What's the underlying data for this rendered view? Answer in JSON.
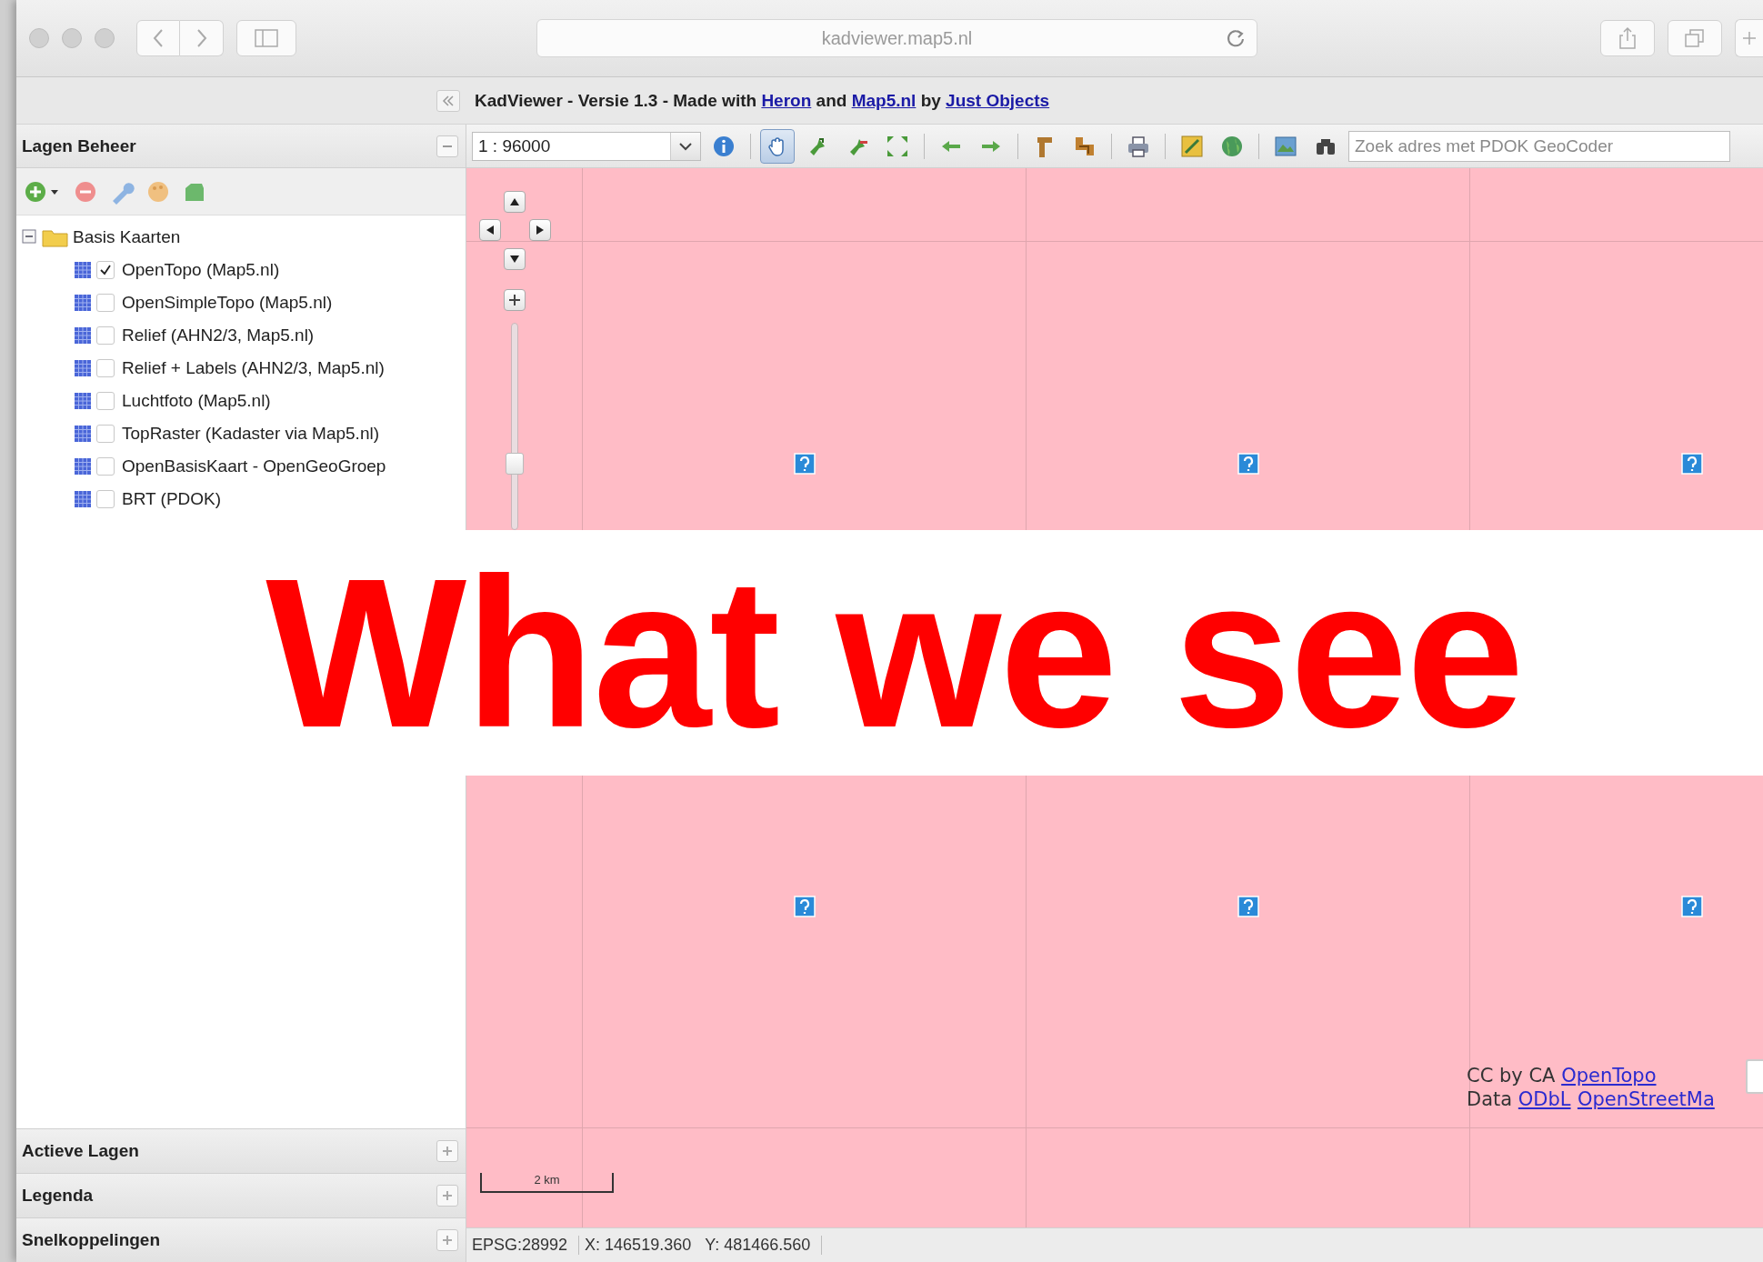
{
  "browser": {
    "url": "kadviewer.map5.nl"
  },
  "header": {
    "parts": [
      {
        "kind": "text",
        "text": "KadViewer - Versie 1.3 - Made with "
      },
      {
        "kind": "link",
        "text": "Heron"
      },
      {
        "kind": "text",
        "text": " and "
      },
      {
        "kind": "link",
        "text": "Map5.nl"
      },
      {
        "kind": "text",
        "text": " by "
      },
      {
        "kind": "link",
        "text": "Just Objects"
      }
    ]
  },
  "layers_panel": {
    "title": "Lagen Beheer",
    "tree": [
      {
        "label": "Basis Kaarten",
        "expanded": true,
        "children": [
          {
            "label": "OpenTopo (Map5.nl)",
            "checked": true
          },
          {
            "label": "OpenSimpleTopo (Map5.nl)",
            "checked": false
          },
          {
            "label": "Relief (AHN2/3, Map5.nl)",
            "checked": false
          },
          {
            "label": "Relief + Labels (AHN2/3, Map5.nl)",
            "checked": false
          },
          {
            "label": "Luchtfoto (Map5.nl)",
            "checked": false
          },
          {
            "label": "TopRaster (Kadaster via Map5.nl)",
            "checked": false
          },
          {
            "label": "OpenBasisKaart - OpenGeoGroep",
            "checked": false
          },
          {
            "label": "BRT (PDOK)",
            "checked": false
          }
        ]
      }
    ]
  },
  "map_toolbar": {
    "scale": "1 : 96000",
    "tool_groups": [
      [
        {
          "kind": "info",
          "selected": false
        }
      ],
      [
        {
          "kind": "pan",
          "selected": true
        },
        {
          "kind": "zoom-in",
          "selected": false
        },
        {
          "kind": "zoom-out",
          "selected": false
        },
        {
          "kind": "extent",
          "selected": false
        }
      ],
      [
        {
          "kind": "back",
          "selected": false
        },
        {
          "kind": "forward",
          "selected": false
        }
      ],
      [
        {
          "kind": "measure-length",
          "selected": false
        },
        {
          "kind": "measure-area",
          "selected": false
        }
      ],
      [
        {
          "kind": "print",
          "selected": false
        }
      ],
      [
        {
          "kind": "draw",
          "selected": false
        },
        {
          "kind": "globe",
          "selected": false
        }
      ],
      [
        {
          "kind": "map",
          "selected": false
        },
        {
          "kind": "binoculars",
          "selected": false
        }
      ]
    ],
    "search": {
      "placeholder": "Zoek adres met PDOK GeoCoder"
    }
  },
  "map": {
    "scale_bar": "2 km",
    "attribution": [
      [
        {
          "kind": "text",
          "text": "CC by CA "
        },
        {
          "kind": "link",
          "text": "OpenTopo"
        }
      ],
      [
        {
          "kind": "text",
          "text": "Data "
        },
        {
          "kind": "link",
          "text": "ODbL"
        },
        {
          "kind": "link",
          "text": "OpenStreetMa"
        }
      ]
    ]
  },
  "panels": [
    {
      "title": "Actieve Lagen"
    },
    {
      "title": "Legenda"
    },
    {
      "title": "Snelkoppelingen"
    }
  ],
  "status_bar": {
    "projection": "EPSG:28992",
    "x": "X: 146519.360",
    "y": "Y: 481466.560"
  },
  "banner": {
    "text": "What we see"
  }
}
